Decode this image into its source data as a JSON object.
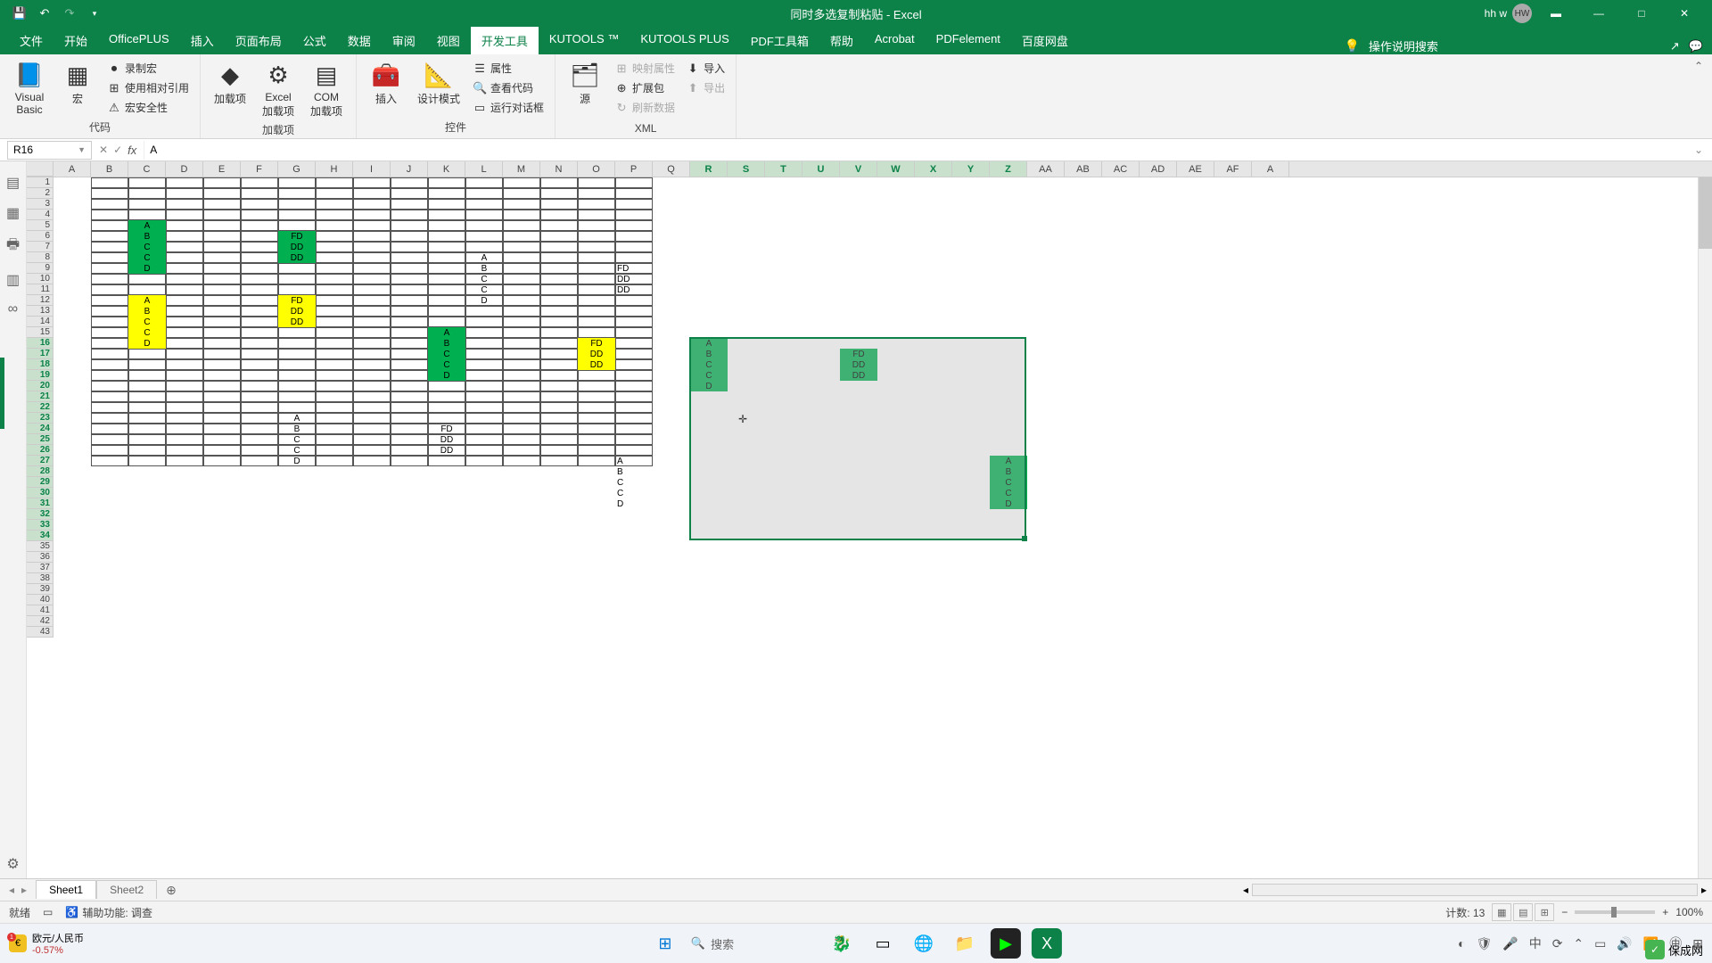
{
  "titlebar": {
    "title": "同时多选复制粘贴 - Excel",
    "user": "hh w",
    "avatar": "HW"
  },
  "tabs": {
    "items": [
      "文件",
      "开始",
      "OfficePLUS",
      "插入",
      "页面布局",
      "公式",
      "数据",
      "审阅",
      "视图",
      "开发工具",
      "KUTOOLS ™",
      "KUTOOLS PLUS",
      "PDF工具箱",
      "帮助",
      "Acrobat",
      "PDFelement",
      "百度网盘"
    ],
    "active_index": 9,
    "tell_me": "操作说明搜索"
  },
  "ribbon": {
    "groups": [
      {
        "label": "代码",
        "big": [
          {
            "icon": "📘",
            "text": "Visual Basic"
          },
          {
            "icon": "▦",
            "text": "宏"
          }
        ],
        "small": [
          {
            "icon": "⏺",
            "text": "录制宏"
          },
          {
            "icon": "⊞",
            "text": "使用相对引用"
          },
          {
            "icon": "⚠",
            "text": "宏安全性"
          }
        ]
      },
      {
        "label": "加载项",
        "big": [
          {
            "icon": "◆",
            "text": "加载项"
          },
          {
            "icon": "⚙",
            "text": "Excel 加载项"
          },
          {
            "icon": "▤",
            "text": "COM 加载项"
          }
        ],
        "small": []
      },
      {
        "label": "控件",
        "big": [
          {
            "icon": "🧰",
            "text": "插入"
          },
          {
            "icon": "📐",
            "text": "设计模式"
          }
        ],
        "small": [
          {
            "icon": "☰",
            "text": "属性"
          },
          {
            "icon": "🔍",
            "text": "查看代码"
          },
          {
            "icon": "▭",
            "text": "运行对话框"
          }
        ]
      },
      {
        "label": "XML",
        "big": [
          {
            "icon": "🗂",
            "text": "源"
          }
        ],
        "small": [
          {
            "icon": "⊞",
            "text": "映射属性",
            "dis": true
          },
          {
            "icon": "⊕",
            "text": "扩展包"
          },
          {
            "icon": "↻",
            "text": "刷新数据",
            "dis": true
          },
          {
            "icon": "⬇",
            "text": "导入"
          },
          {
            "icon": "⬆",
            "text": "导出",
            "dis": true
          }
        ]
      }
    ]
  },
  "fbar": {
    "name": "R16",
    "formula": "A"
  },
  "columns": [
    "A",
    "B",
    "C",
    "D",
    "E",
    "F",
    "G",
    "H",
    "I",
    "J",
    "K",
    "L",
    "M",
    "N",
    "O",
    "P",
    "Q",
    "R",
    "S",
    "T",
    "U",
    "V",
    "W",
    "X",
    "Y",
    "Z",
    "AA",
    "AB",
    "AC",
    "AD",
    "AE",
    "AF",
    "A"
  ],
  "row_count": 43,
  "cells": [
    {
      "r": 5,
      "c": 3,
      "v": "A",
      "f": "green"
    },
    {
      "r": 6,
      "c": 3,
      "v": "B",
      "f": "green"
    },
    {
      "r": 7,
      "c": 3,
      "v": "C",
      "f": "green"
    },
    {
      "r": 8,
      "c": 3,
      "v": "C",
      "f": "green"
    },
    {
      "r": 9,
      "c": 3,
      "v": "D",
      "f": "green"
    },
    {
      "r": 6,
      "c": 7,
      "v": "FD",
      "f": "green"
    },
    {
      "r": 7,
      "c": 7,
      "v": "DD",
      "f": "green"
    },
    {
      "r": 8,
      "c": 7,
      "v": "DD",
      "f": "green"
    },
    {
      "r": 8,
      "c": 12,
      "v": "A"
    },
    {
      "r": 9,
      "c": 12,
      "v": "B"
    },
    {
      "r": 10,
      "c": 12,
      "v": "C"
    },
    {
      "r": 11,
      "c": 12,
      "v": "C"
    },
    {
      "r": 12,
      "c": 12,
      "v": "D"
    },
    {
      "r": 9,
      "c": 16,
      "v": "FD",
      "left": true
    },
    {
      "r": 10,
      "c": 16,
      "v": "DD",
      "left": true
    },
    {
      "r": 11,
      "c": 16,
      "v": "DD",
      "left": true
    },
    {
      "r": 12,
      "c": 3,
      "v": "A",
      "f": "yellow"
    },
    {
      "r": 13,
      "c": 3,
      "v": "B",
      "f": "yellow"
    },
    {
      "r": 14,
      "c": 3,
      "v": "C",
      "f": "yellow"
    },
    {
      "r": 15,
      "c": 3,
      "v": "C",
      "f": "yellow"
    },
    {
      "r": 16,
      "c": 3,
      "v": "D",
      "f": "yellow"
    },
    {
      "r": 12,
      "c": 7,
      "v": "FD",
      "f": "yellow"
    },
    {
      "r": 13,
      "c": 7,
      "v": "DD",
      "f": "yellow"
    },
    {
      "r": 14,
      "c": 7,
      "v": "DD",
      "f": "yellow"
    },
    {
      "r": 15,
      "c": 11,
      "v": "A",
      "f": "green"
    },
    {
      "r": 16,
      "c": 11,
      "v": "B",
      "f": "green"
    },
    {
      "r": 17,
      "c": 11,
      "v": "C",
      "f": "green"
    },
    {
      "r": 18,
      "c": 11,
      "v": "C",
      "f": "green"
    },
    {
      "r": 19,
      "c": 11,
      "v": "D",
      "f": "green"
    },
    {
      "r": 16,
      "c": 15,
      "v": "FD",
      "f": "yellow"
    },
    {
      "r": 17,
      "c": 15,
      "v": "DD",
      "f": "yellow"
    },
    {
      "r": 18,
      "c": 15,
      "v": "DD",
      "f": "yellow"
    },
    {
      "r": 23,
      "c": 7,
      "v": "A"
    },
    {
      "r": 24,
      "c": 7,
      "v": "B"
    },
    {
      "r": 25,
      "c": 7,
      "v": "C"
    },
    {
      "r": 26,
      "c": 7,
      "v": "C"
    },
    {
      "r": 27,
      "c": 7,
      "v": "D"
    },
    {
      "r": 24,
      "c": 11,
      "v": "FD"
    },
    {
      "r": 25,
      "c": 11,
      "v": "DD"
    },
    {
      "r": 26,
      "c": 11,
      "v": "DD"
    },
    {
      "r": 27,
      "c": 16,
      "v": "A",
      "left": true
    },
    {
      "r": 28,
      "c": 16,
      "v": "B",
      "left": true
    },
    {
      "r": 29,
      "c": 16,
      "v": "C",
      "left": true
    },
    {
      "r": 30,
      "c": 16,
      "v": "C",
      "left": true
    },
    {
      "r": 31,
      "c": 16,
      "v": "D",
      "left": true
    },
    {
      "r": 16,
      "c": 18,
      "v": "A",
      "f": "green"
    },
    {
      "r": 17,
      "c": 18,
      "v": "B",
      "f": "green"
    },
    {
      "r": 18,
      "c": 18,
      "v": "C",
      "f": "green"
    },
    {
      "r": 19,
      "c": 18,
      "v": "C",
      "f": "green"
    },
    {
      "r": 20,
      "c": 18,
      "v": "D",
      "f": "green"
    },
    {
      "r": 17,
      "c": 22,
      "v": "FD",
      "f": "green"
    },
    {
      "r": 18,
      "c": 22,
      "v": "DD",
      "f": "green"
    },
    {
      "r": 19,
      "c": 22,
      "v": "DD",
      "f": "green"
    },
    {
      "r": 27,
      "c": 26,
      "v": "A",
      "f": "green"
    },
    {
      "r": 28,
      "c": 26,
      "v": "B",
      "f": "green"
    },
    {
      "r": 29,
      "c": 26,
      "v": "C",
      "f": "green"
    },
    {
      "r": 30,
      "c": 26,
      "v": "C",
      "f": "green"
    },
    {
      "r": 31,
      "c": 26,
      "v": "D",
      "f": "green"
    }
  ],
  "borders": [
    {
      "r1": 1,
      "c1": 2,
      "r2": 27,
      "c2": 16,
      "grid": true
    }
  ],
  "selection": {
    "r1": 16,
    "c1": 18,
    "r2": 34,
    "c2": 26
  },
  "cursor": {
    "r": 23,
    "c": 19
  },
  "sheet_tabs": {
    "tabs": [
      "Sheet1",
      "Sheet2"
    ],
    "active": 0
  },
  "status": {
    "ready": "就绪",
    "acc": "辅助功能: 调查",
    "count_label": "计数:",
    "count": 13,
    "zoom": "100%"
  },
  "taskbar": {
    "stock_name": "欧元/人民币",
    "stock_val": "-0.57%",
    "search": "搜索"
  },
  "watermark": "保成网",
  "colors": {
    "green": "#00b050",
    "yellow": "#ffff00",
    "excel": "#0c8148"
  }
}
